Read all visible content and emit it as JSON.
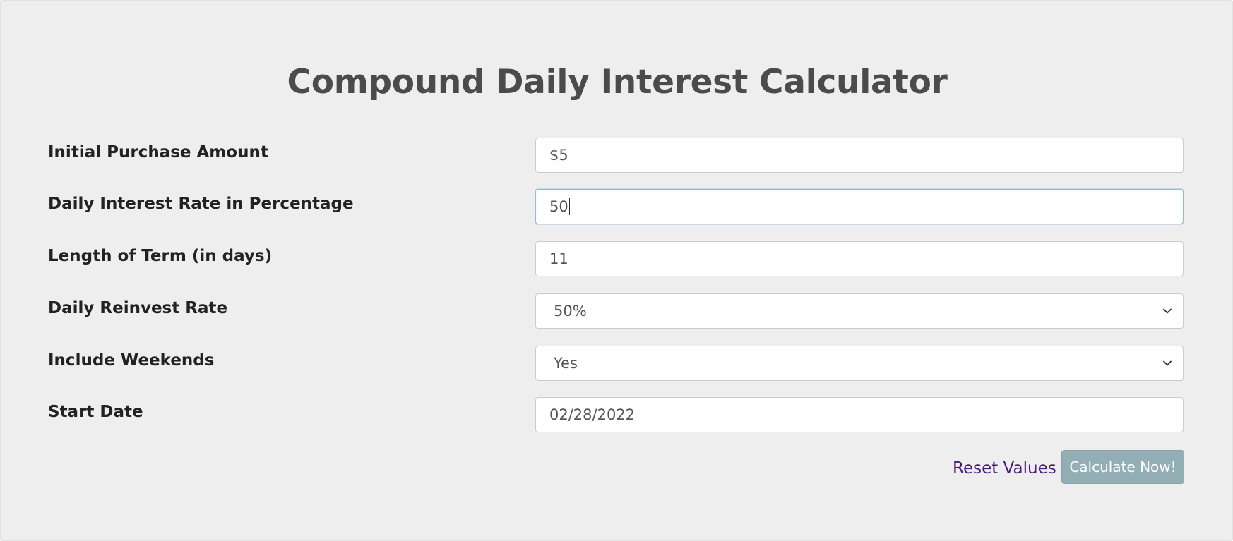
{
  "page": {
    "title": "Compound Daily Interest Calculator"
  },
  "form": {
    "initial_purchase": {
      "label": "Initial Purchase Amount",
      "value": "$5"
    },
    "daily_rate": {
      "label": "Daily Interest Rate in Percentage",
      "value": "50"
    },
    "term_length": {
      "label": "Length of Term (in days)",
      "value": "11"
    },
    "reinvest_rate": {
      "label": "Daily Reinvest Rate",
      "selected": "50%"
    },
    "include_weekends": {
      "label": "Include Weekends",
      "selected": "Yes"
    },
    "start_date": {
      "label": "Start Date",
      "value": "02/28/2022"
    }
  },
  "actions": {
    "reset_label": "Reset Values",
    "calculate_label": "Calculate Now!"
  },
  "colors": {
    "background": "#eeeeee",
    "title": "#4b4b4b",
    "label": "#222222",
    "link": "#4a1a7a",
    "button": "#93aeb5"
  },
  "icons": {
    "select_arrow": "chevron-down-icon"
  }
}
